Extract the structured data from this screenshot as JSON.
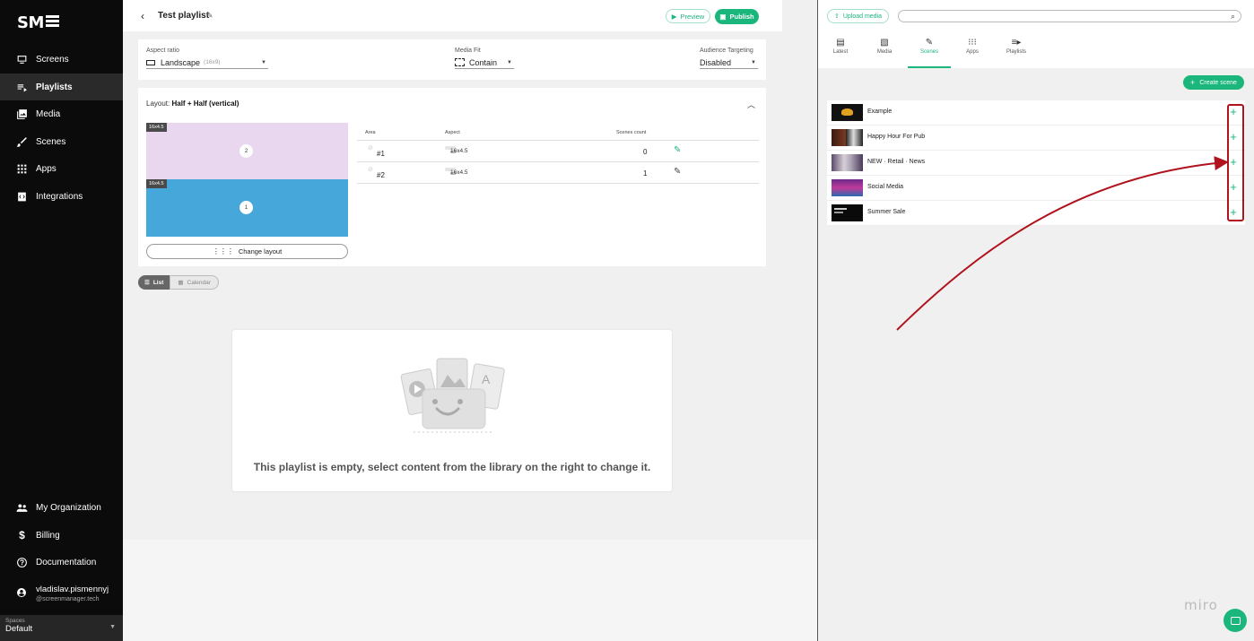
{
  "app": {
    "logo_text": "SM"
  },
  "sidebar": {
    "items": [
      {
        "label": "Screens",
        "icon": "monitor-icon"
      },
      {
        "label": "Playlists",
        "icon": "playlist-icon"
      },
      {
        "label": "Media",
        "icon": "media-icon"
      },
      {
        "label": "Scenes",
        "icon": "brush-icon"
      },
      {
        "label": "Apps",
        "icon": "apps-grid-icon"
      },
      {
        "label": "Integrations",
        "icon": "integrations-icon"
      }
    ],
    "bottom_items": [
      {
        "label": "My Organization",
        "icon": "people-icon"
      },
      {
        "label": "Billing",
        "icon": "dollar-icon"
      },
      {
        "label": "Documentation",
        "icon": "help-icon"
      }
    ],
    "user": {
      "name": "vladislav.pismennyj",
      "email": "@screenmanager.tech"
    },
    "spaces": {
      "label": "Spaces",
      "value": "Default"
    }
  },
  "topbar": {
    "title": "Test playlist",
    "preview_label": "Preview",
    "publish_label": "Publish"
  },
  "settings": {
    "aspect_ratio": {
      "label": "Aspect ratio",
      "value": "Landscape",
      "hint": "(16x9)"
    },
    "media_fit": {
      "label": "Media Fit",
      "value": "Contain"
    },
    "audience": {
      "label": "Audience Targeting",
      "value": "Disabled"
    }
  },
  "layout": {
    "prefix": "Layout:",
    "name": "Half + Half (vertical)",
    "top_area": {
      "badge": "16x4.5",
      "number": "2"
    },
    "bottom_area": {
      "badge": "16x4.5",
      "number": "1"
    },
    "change_label": "Change layout",
    "table": {
      "headers": [
        "Area",
        "Aspect",
        "Scenes count"
      ],
      "rows": [
        {
          "area": "#1",
          "aspect": "16x4.5",
          "count": "0"
        },
        {
          "area": "#2",
          "aspect": "16x4.5",
          "count": "1"
        }
      ]
    }
  },
  "view_toggle": {
    "list": "List",
    "calendar": "Calendar"
  },
  "empty_state": {
    "text": "This playlist is empty, select content from the library on the right to change it."
  },
  "library": {
    "upload_label": "Upload media",
    "search_placeholder": "",
    "tabs": [
      {
        "label": "Latest",
        "icon": "latest-icon"
      },
      {
        "label": "Media",
        "icon": "image-icon"
      },
      {
        "label": "Scenes",
        "icon": "brush-icon"
      },
      {
        "label": "Apps",
        "icon": "apps-grid-icon"
      },
      {
        "label": "Playlists",
        "icon": "playlist-icon"
      }
    ],
    "active_tab": "Scenes",
    "create_label": "Create scene",
    "scenes": [
      {
        "name": "Example"
      },
      {
        "name": "Happy Hour For Pub"
      },
      {
        "name": "NEW · Retail · News"
      },
      {
        "name": "Social Media"
      },
      {
        "name": "Summer Sale"
      }
    ]
  },
  "overlay": {
    "watermark": "miro"
  },
  "colors": {
    "accent": "#1ab67c",
    "sidebar_bg": "#0b0b0b",
    "annotation_red": "#b0131d",
    "area_top": "#e9d7f0",
    "area_bottom": "#46a8da"
  }
}
